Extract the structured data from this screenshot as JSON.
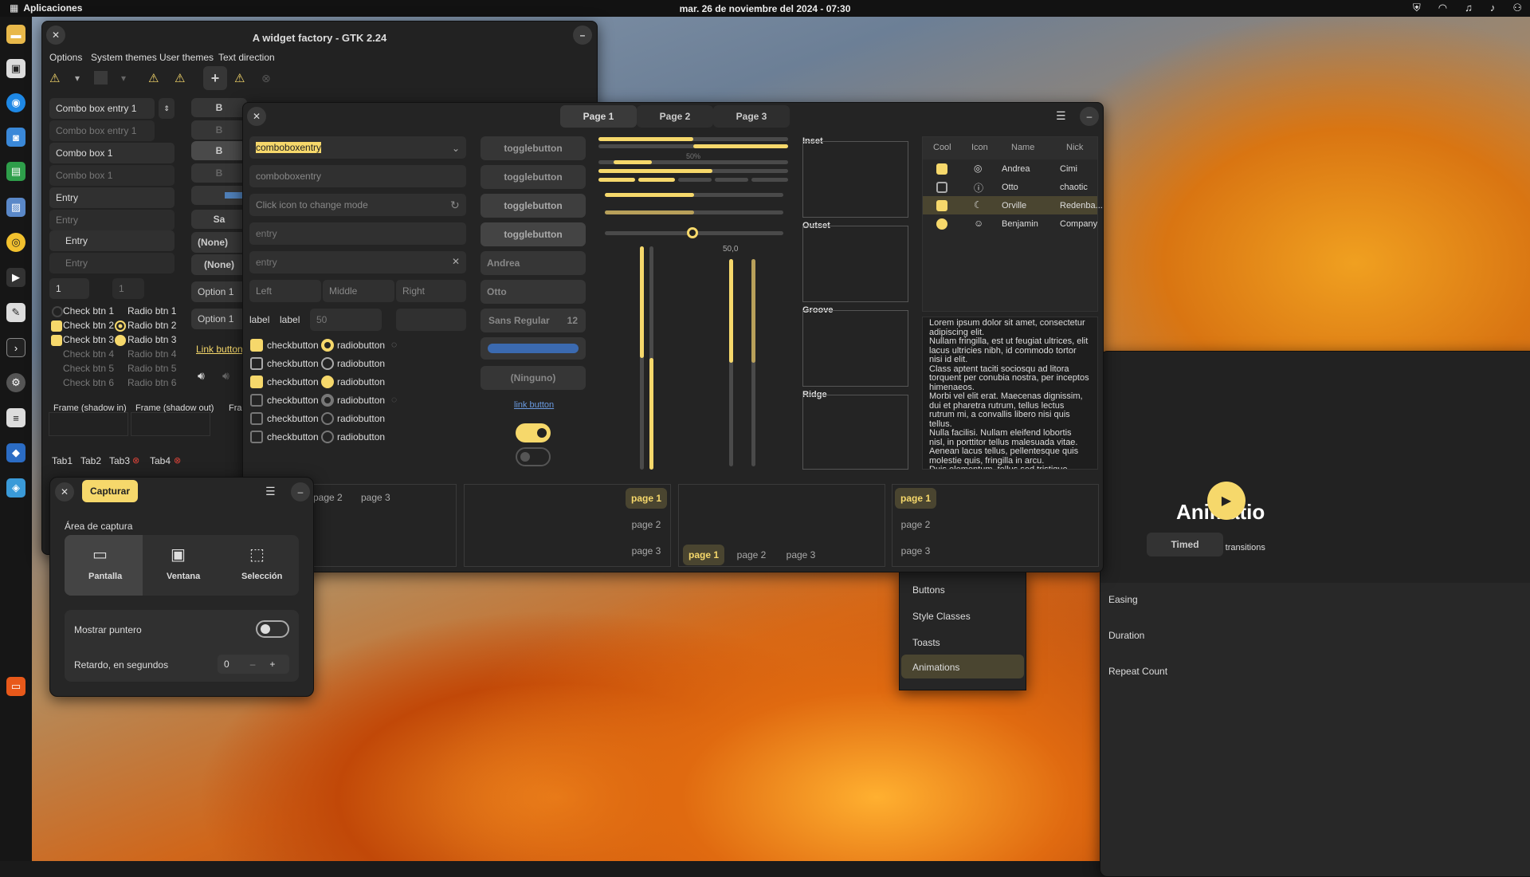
{
  "topbar": {
    "apps": "Aplicaciones",
    "clock": "mar. 26 de noviembre del 2024 - 07:30"
  },
  "factory": {
    "title": "A widget factory - GTK 2.24",
    "menu": [
      "Options",
      "System themes",
      "User themes",
      "Text direction"
    ],
    "left": {
      "combo1": "Combo box entry 1",
      "combo2": "Combo box entry 1",
      "combo3": "Combo box 1",
      "combo4": "Combo box 1",
      "entry1": "Entry",
      "entry2": "Entry",
      "entry3": "Entry",
      "entry4": "Entry",
      "spin1": "1",
      "spin2": "1",
      "checks": [
        "Check btn 1",
        "Check btn 2",
        "Check btn 3",
        "Check btn 4",
        "Check btn 5",
        "Check btn 6"
      ],
      "radios": [
        "Radio btn 1",
        "Radio btn 2",
        "Radio btn 3",
        "Radio btn 4",
        "Radio btn 5",
        "Radio btn 6"
      ],
      "frames": [
        "Frame (shadow in)",
        "Frame (shadow out)",
        "Fran"
      ],
      "tabs": [
        "Tab1",
        "Tab2",
        "Tab3",
        "Tab4"
      ]
    },
    "mid": {
      "b1": "B",
      "b2": "B",
      "b3": "B",
      "b4": "B",
      "sa": "Sa",
      "none1": "(None)",
      "none2": "(None)",
      "opt1": "Option 1",
      "opt2": "Option 1",
      "link": "Link button"
    }
  },
  "gtk4": {
    "tabs": [
      "Page 1",
      "Page 2",
      "Page 3"
    ],
    "col1": {
      "combo_entry": "comboboxentry",
      "combo_entry2": "comboboxentry",
      "icon_field": "Click icon to change mode",
      "entry1": "entry",
      "entry2": "entry",
      "left": "Left",
      "middle": "Middle",
      "right": "Right",
      "label1": "label",
      "label2": "label",
      "spin": "50",
      "checkbuttons": [
        "checkbutton",
        "checkbutton",
        "checkbutton",
        "checkbutton",
        "checkbutton",
        "checkbutton"
      ],
      "radiobuttons": [
        "radiobutton",
        "radiobutton",
        "radiobutton",
        "radiobutton",
        "radiobutton",
        "radiobutton"
      ]
    },
    "col2": {
      "toggles": [
        "togglebutton",
        "togglebutton",
        "togglebutton",
        "togglebutton"
      ],
      "combo_andrea": "Andrea",
      "combo_otto": "Otto",
      "font": "Sans Regular",
      "font_size": "12",
      "ninguno": "(Ninguno)",
      "link": "link button"
    },
    "col3": {
      "progress_label": "50%",
      "scale_label": "50,0",
      "progress": 0.5
    },
    "frames": [
      "Inset",
      "Outset",
      "Groove",
      "Ridge"
    ],
    "table": {
      "headers": [
        "Cool",
        "Icon",
        "Name",
        "Nick"
      ],
      "rows": [
        {
          "name": "Andrea",
          "nick": "Cimi"
        },
        {
          "name": "Otto",
          "nick": "chaotic"
        },
        {
          "name": "Orville",
          "nick": "Redenba..."
        },
        {
          "name": "Benjamin",
          "nick": "Company"
        }
      ]
    },
    "lorem": "Lorem ipsum dolor sit amet, consectetur adipiscing elit.\nNullam fringilla, est ut feugiat ultrices, elit lacus ultricies nibh, id commodo tortor nisi id elit.\nClass aptent taciti sociosqu ad litora torquent per conubia nostra, per inceptos himenaeos.\nMorbi vel elit erat. Maecenas dignissim, dui et pharetra rutrum, tellus lectus rutrum mi, a convallis libero nisi quis tellus.\nNulla facilisi. Nullam eleifend lobortis nisl, in porttitor tellus malesuada vitae.\nAenean lacus tellus, pellentesque quis molestie quis, fringilla in arcu.\nDuis elementum, tellus sed tristique semper, metus metus accumsan augue, et porttitor augue orci a libero.",
    "bottom_tabs": {
      "a": [
        "page 2",
        "page 3"
      ],
      "b": [
        "page 1",
        "page 2",
        "page 3"
      ],
      "c": [
        "page 1",
        "page 2",
        "page 3"
      ],
      "d": [
        "page 1",
        "page 2",
        "page 3"
      ]
    }
  },
  "capture": {
    "capturar": "Capturar",
    "area_label": "Área de captura",
    "options": [
      "Pantalla",
      "Ventana",
      "Selección"
    ],
    "pointer": "Mostrar puntero",
    "delay": "Retardo, en segundos",
    "delay_value": "0"
  },
  "demo": {
    "title": "Animatio",
    "subtitle": "Simple transitions",
    "timed": "Timed",
    "sidebar": [
      "Buttons",
      "Style Classes",
      "Toasts",
      "Animations"
    ],
    "props": [
      "Easing",
      "Duration",
      "Repeat Count"
    ]
  }
}
